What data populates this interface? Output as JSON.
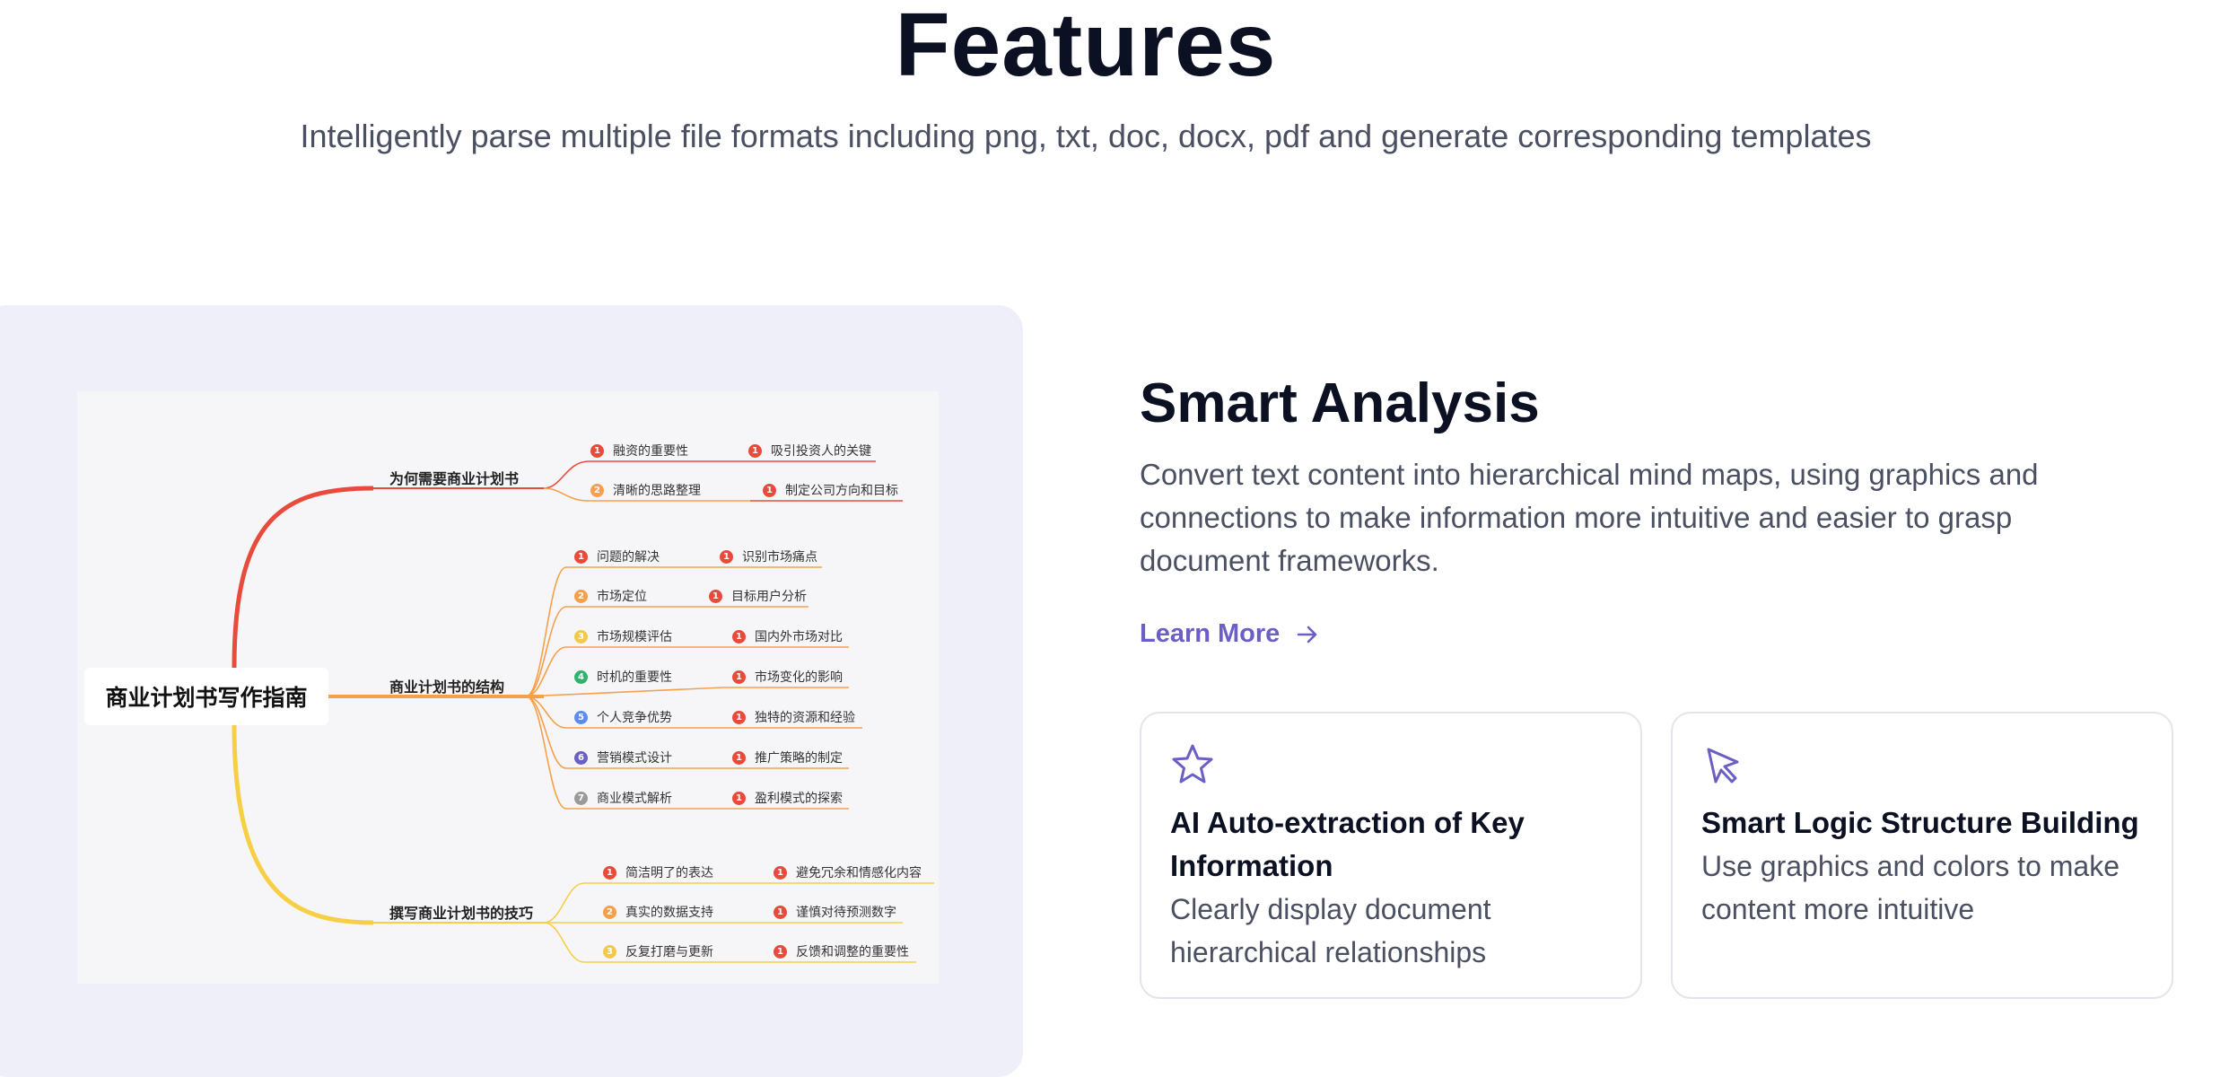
{
  "header": {
    "title": "Features",
    "subtitle": "Intelligently parse multiple file formats including png, txt, doc, docx, pdf and generate corresponding templates"
  },
  "mindmap": {
    "root": "商业计划书写作指南",
    "branches": [
      {
        "label": "为何需要商业计划书",
        "items": [
          {
            "n": "1",
            "text": "融资的重要性",
            "sub_n": "1",
            "sub": "吸引投资人的关键"
          },
          {
            "n": "2",
            "text": "清晰的思路整理",
            "sub_n": "1",
            "sub": "制定公司方向和目标"
          }
        ]
      },
      {
        "label": "商业计划书的结构",
        "items": [
          {
            "n": "1",
            "text": "问题的解决",
            "sub_n": "1",
            "sub": "识别市场痛点"
          },
          {
            "n": "2",
            "text": "市场定位",
            "sub_n": "1",
            "sub": "目标用户分析"
          },
          {
            "n": "3",
            "text": "市场规模评估",
            "sub_n": "1",
            "sub": "国内外市场对比"
          },
          {
            "n": "4",
            "text": "时机的重要性",
            "sub_n": "1",
            "sub": "市场变化的影响"
          },
          {
            "n": "5",
            "text": "个人竞争优势",
            "sub_n": "1",
            "sub": "独特的资源和经验"
          },
          {
            "n": "6",
            "text": "营销模式设计",
            "sub_n": "1",
            "sub": "推广策略的制定"
          },
          {
            "n": "7",
            "text": "商业模式解析",
            "sub_n": "1",
            "sub": "盈利模式的探索"
          }
        ]
      },
      {
        "label": "撰写商业计划书的技巧",
        "items": [
          {
            "n": "1",
            "text": "简洁明了的表达",
            "sub_n": "1",
            "sub": "避免冗余和情感化内容"
          },
          {
            "n": "2",
            "text": "真实的数据支持",
            "sub_n": "1",
            "sub": "谨慎对待预测数字"
          },
          {
            "n": "3",
            "text": "反复打磨与更新",
            "sub_n": "1",
            "sub": "反馈和调整的重要性"
          }
        ]
      }
    ],
    "colors": {
      "branch1": "#e84b3c",
      "branch2": "#f5a04a",
      "branch3": "#f7cf45",
      "num_red": "#e84b3c",
      "num_orange": "#f5a04a",
      "num_yellow": "#f2c94c",
      "num_green": "#2fb36d",
      "num_blue": "#5b8def",
      "num_purple": "#6a5fc4",
      "num_gray": "#9a9a9a"
    }
  },
  "feature": {
    "title": "Smart Analysis",
    "description": "Convert text content into hierarchical mind maps, using graphics and connections to make information more intuitive and easier to grasp document frameworks.",
    "learn_more": "Learn More",
    "accent": "#6a5fc4"
  },
  "cards": [
    {
      "icon": "star-icon",
      "title": "AI Auto-extraction of Key Information",
      "description": "Clearly display document hierarchical relationships"
    },
    {
      "icon": "cursor-arrow-icon",
      "title": "Smart Logic Structure Building",
      "description": "Use graphics and colors to make content more intuitive"
    }
  ]
}
